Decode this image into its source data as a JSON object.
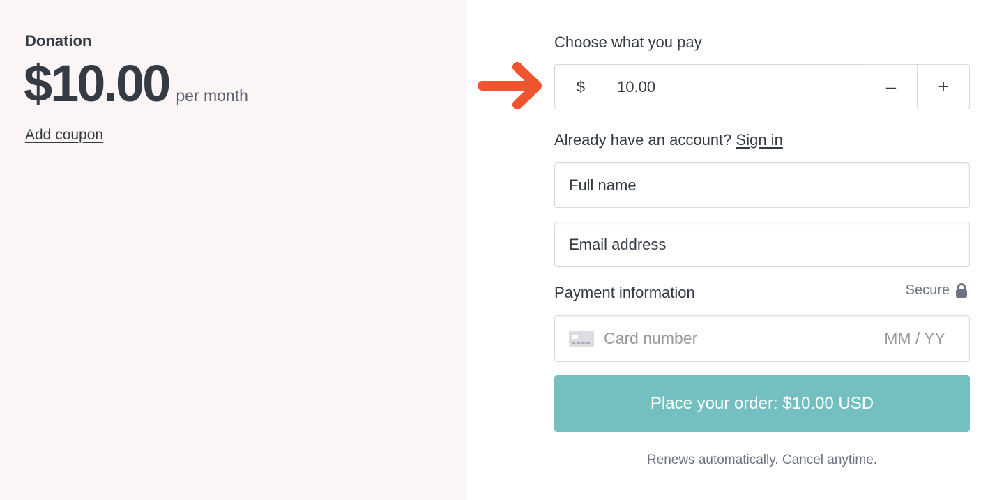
{
  "summary": {
    "product_name": "Donation",
    "price": "$10.00",
    "period": "per month",
    "coupon_link": "Add coupon"
  },
  "checkout": {
    "pay_label": "Choose what you pay",
    "currency_symbol": "$",
    "amount_value": "10.00",
    "decrement_label": "–",
    "increment_label": "+",
    "account_prompt": "Already have an account?",
    "sign_in_link": "Sign in",
    "full_name_placeholder": "Full name",
    "email_placeholder": "Email address",
    "payment_label": "Payment information",
    "secure_label": "Secure",
    "card_number_placeholder": "Card number",
    "card_expiry_placeholder": "MM / YY",
    "order_button": "Place your order: $10.00 USD",
    "renew_note": "Renews automatically. Cancel anytime."
  },
  "icons": {
    "annotation": "arrow-right-icon",
    "secure": "lock-icon",
    "card": "credit-card-icon"
  },
  "colors": {
    "left_panel_bg": "#fcf5f5",
    "button_bg": "#74c0c0",
    "annotation_arrow": "#ef5630",
    "text": "#353b45",
    "muted_text": "#6b7384"
  }
}
